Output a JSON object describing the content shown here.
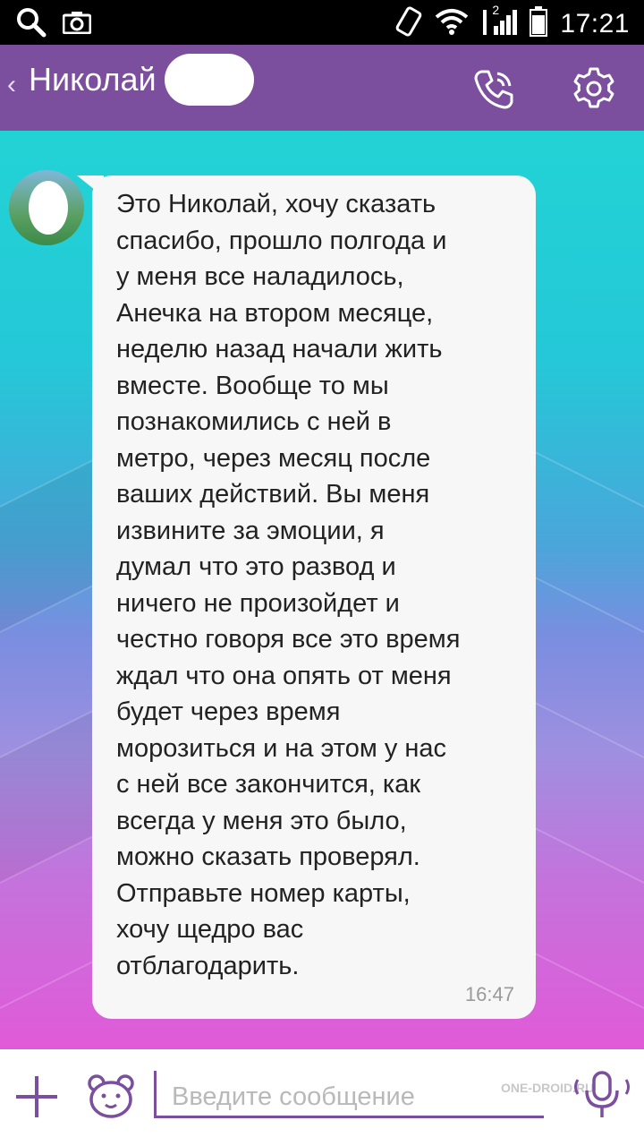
{
  "status_bar": {
    "time": "17:21",
    "icons": [
      "search-icon",
      "camera-icon",
      "rotate-icon",
      "wifi-icon",
      "signal-icon",
      "battery-icon"
    ],
    "signal_label": "2"
  },
  "header": {
    "back_icon": "chevron-left-icon",
    "contact_name": "Николай",
    "call_icon": "phone-icon",
    "settings_icon": "gear-icon",
    "color": "#7b4f9e"
  },
  "messages": [
    {
      "sender": "Николай",
      "text": "Это Николай, хочу сказать\nспасибо, прошло полгода и\nу меня все наладилось,\nАнечка на втором месяце,\nнеделю назад начали жить\nвместе. Вообще то мы\nпознакомились с ней в\nметро, через месяц после\nваших действий. Вы меня\nизвините за эмоции, я\nдумал что это развод и\nничего не произойдет и\nчестно говоря все это время\nждал что она опять от меня\nбудет через  время\nморозиться и на этом у нас\nс ней все закончится, как\nвсегда у меня это было,\nможно сказать проверял.\nОтправьте номер карты,\nхочу щедро вас\nотблагодарить.",
      "time": "16:47"
    }
  ],
  "composer": {
    "add_icon": "plus-icon",
    "sticker_icon": "bear-icon",
    "placeholder": "Введите сообщение",
    "value": "",
    "voice_icon": "microphone-icon",
    "watermark": "ONE-DROID.RU"
  }
}
